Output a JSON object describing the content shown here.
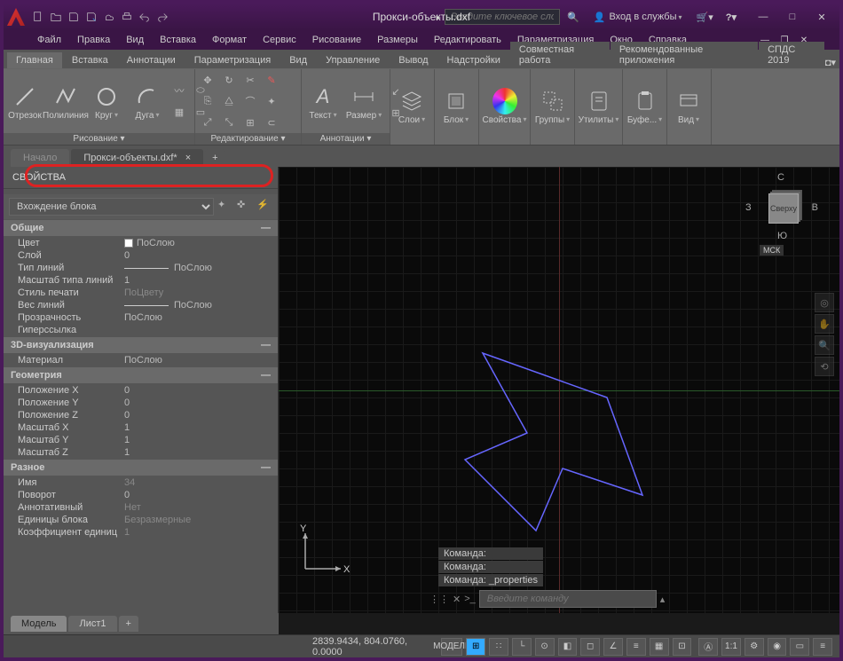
{
  "title": "Прокси-объекты.dxf",
  "search_placeholder": "Введите ключевое слово/фразу",
  "signin_label": "Вход в службы",
  "menubar": [
    "Файл",
    "Правка",
    "Вид",
    "Вставка",
    "Формат",
    "Сервис",
    "Рисование",
    "Размеры",
    "Редактировать",
    "Параметризация",
    "Окно",
    "Справка"
  ],
  "ribbon_tabs": [
    "Главная",
    "Вставка",
    "Аннотации",
    "Параметризация",
    "Вид",
    "Управление",
    "Вывод",
    "Надстройки",
    "Совместная работа",
    "Рекомендованные приложения",
    "СПДС 2019"
  ],
  "ribbon_tabs_active": 0,
  "ribbon_panels": {
    "draw": {
      "label": "Рисование ▾",
      "segment": "Отрезок",
      "polyline": "Полилиния",
      "circle": "Круг",
      "arc": "Дуга"
    },
    "edit": {
      "label": "Редактирование ▾"
    },
    "annot": {
      "label": "Аннотации ▾",
      "text": "Текст",
      "dim": "Размер"
    },
    "layers": {
      "label": "Слои"
    },
    "block": {
      "label": "Блок"
    },
    "props": {
      "label": "Свойства"
    },
    "groups": {
      "label": "Группы"
    },
    "utils": {
      "label": "Утилиты"
    },
    "clip": {
      "label": "Буфе..."
    },
    "view": {
      "label": "Вид"
    }
  },
  "doc_tabs": {
    "start": "Начало",
    "active": "Прокси-объекты.dxf*"
  },
  "properties_title": "СВОЙСТВА",
  "props_selector": "Вхождение блока",
  "sections": {
    "general": {
      "title": "Общие",
      "rows": [
        {
          "label": "Цвет",
          "value": "ПоСлою",
          "swatch": true
        },
        {
          "label": "Слой",
          "value": "0"
        },
        {
          "label": "Тип линий",
          "value": "ПоСлою",
          "line": true
        },
        {
          "label": "Масштаб типа линий",
          "value": "1"
        },
        {
          "label": "Стиль печати",
          "value": "ПоЦвету",
          "dim": true
        },
        {
          "label": "Вес линий",
          "value": "ПоСлою",
          "line": true
        },
        {
          "label": "Прозрачность",
          "value": "ПоСлою"
        },
        {
          "label": "Гиперссылка",
          "value": ""
        }
      ]
    },
    "viz3d": {
      "title": "3D-визуализация",
      "rows": [
        {
          "label": "Материал",
          "value": "ПоСлою"
        }
      ]
    },
    "geom": {
      "title": "Геометрия",
      "rows": [
        {
          "label": "Положение X",
          "value": "0"
        },
        {
          "label": "Положение Y",
          "value": "0"
        },
        {
          "label": "Положение Z",
          "value": "0"
        },
        {
          "label": "Масштаб X",
          "value": "1"
        },
        {
          "label": "Масштаб Y",
          "value": "1"
        },
        {
          "label": "Масштаб Z",
          "value": "1"
        }
      ]
    },
    "misc": {
      "title": "Разное",
      "rows": [
        {
          "label": "Имя",
          "value": "34",
          "dim": true
        },
        {
          "label": "Поворот",
          "value": "0"
        },
        {
          "label": "Аннотативный",
          "value": "Нет",
          "dim": true
        },
        {
          "label": "Единицы блока",
          "value": "Безразмерные",
          "dim": true
        },
        {
          "label": "Коэффициент единиц",
          "value": "1",
          "dim": true
        }
      ]
    }
  },
  "viewcube": {
    "face": "Сверху",
    "n": "С",
    "s": "Ю",
    "e": "В",
    "w": "З",
    "wcs": "МСК"
  },
  "cmd_history": [
    "Команда:",
    "Команда:",
    "Команда: _properties"
  ],
  "cmd_placeholder": "Введите команду",
  "layout_tabs": [
    "Модель",
    "Лист1"
  ],
  "status_coords": "2839.9434, 804.0760, 0.0000",
  "status_model": "МОДЕЛЬ",
  "ucs_labels": {
    "x": "X",
    "y": "Y"
  }
}
